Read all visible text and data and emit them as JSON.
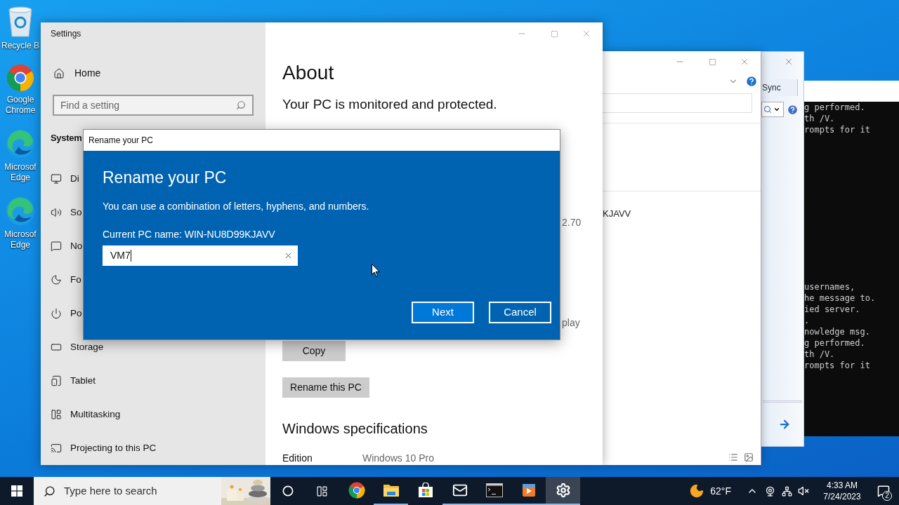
{
  "desktop_icons": [
    {
      "kind": "recycle-bin",
      "label_lines": [
        "Recycle B"
      ]
    },
    {
      "kind": "chrome",
      "label_lines": [
        "Google",
        "Chrome"
      ]
    },
    {
      "kind": "edge",
      "label_lines": [
        "Microsof",
        "Edge"
      ]
    },
    {
      "kind": "edge",
      "label_lines": [
        "Microsof",
        "Edge"
      ]
    }
  ],
  "console": {
    "blocks": [
      [
        "g performed.",
        "th /V.",
        "rompts for it"
      ],
      [
        "usernames,",
        "he message to.",
        "ied server.",
        ".",
        "nowledge msg.",
        "g performed.",
        "th /V.",
        "rompts for it"
      ]
    ]
  },
  "back_window": {
    "tab": "Sync"
  },
  "explorer_window": {
    "fragment": "KJAVV"
  },
  "settings": {
    "title": "Settings",
    "sidebar": {
      "home": "Home",
      "search_placeholder": "Find a setting",
      "section": "System",
      "items": [
        {
          "kind": "display",
          "label": "Di"
        },
        {
          "kind": "sound",
          "label": "So"
        },
        {
          "kind": "notifications",
          "label": "No"
        },
        {
          "kind": "focus",
          "label": "Fo"
        },
        {
          "kind": "power",
          "label": "Po"
        },
        {
          "kind": "storage",
          "label": "Storage"
        },
        {
          "kind": "tablet",
          "label": "Tablet"
        },
        {
          "kind": "multitasking",
          "label": "Multitasking"
        },
        {
          "kind": "projecting",
          "label": "Projecting to this PC"
        }
      ]
    },
    "content": {
      "title": "About",
      "status": "Your PC is monitored and protected.",
      "fragments": [
        "2.70",
        "play"
      ],
      "buttons": [
        "Copy",
        "Rename this PC"
      ],
      "spec_heading": "Windows specifications",
      "specs": [
        {
          "label": "Edition",
          "value": "Windows 10 Pro"
        }
      ]
    }
  },
  "dialog": {
    "title": "Rename your PC",
    "heading": "Rename your PC",
    "hint": "You can use a combination of letters, hyphens, and numbers.",
    "current_name": "Current PC name: WIN-NU8D99KJAVV",
    "input_value": "VM7",
    "buttons": [
      {
        "label": "Next",
        "primary": true
      },
      {
        "label": "Cancel",
        "primary": false
      }
    ]
  },
  "taskbar": {
    "search_placeholder": "Type here to search",
    "apps": [
      {
        "kind": "chrome",
        "running": false,
        "selected": false
      },
      {
        "kind": "explorer",
        "running": true,
        "selected": false
      },
      {
        "kind": "store",
        "running": false,
        "selected": false
      },
      {
        "kind": "mail",
        "running": true,
        "selected": false
      },
      {
        "kind": "terminal",
        "running": true,
        "selected": false
      },
      {
        "kind": "media",
        "running": true,
        "selected": false
      },
      {
        "kind": "settings",
        "running": true,
        "selected": true
      }
    ],
    "weather": "62°F",
    "time": "4:33 AM",
    "date": "7/24/2023",
    "notifications": "2"
  }
}
